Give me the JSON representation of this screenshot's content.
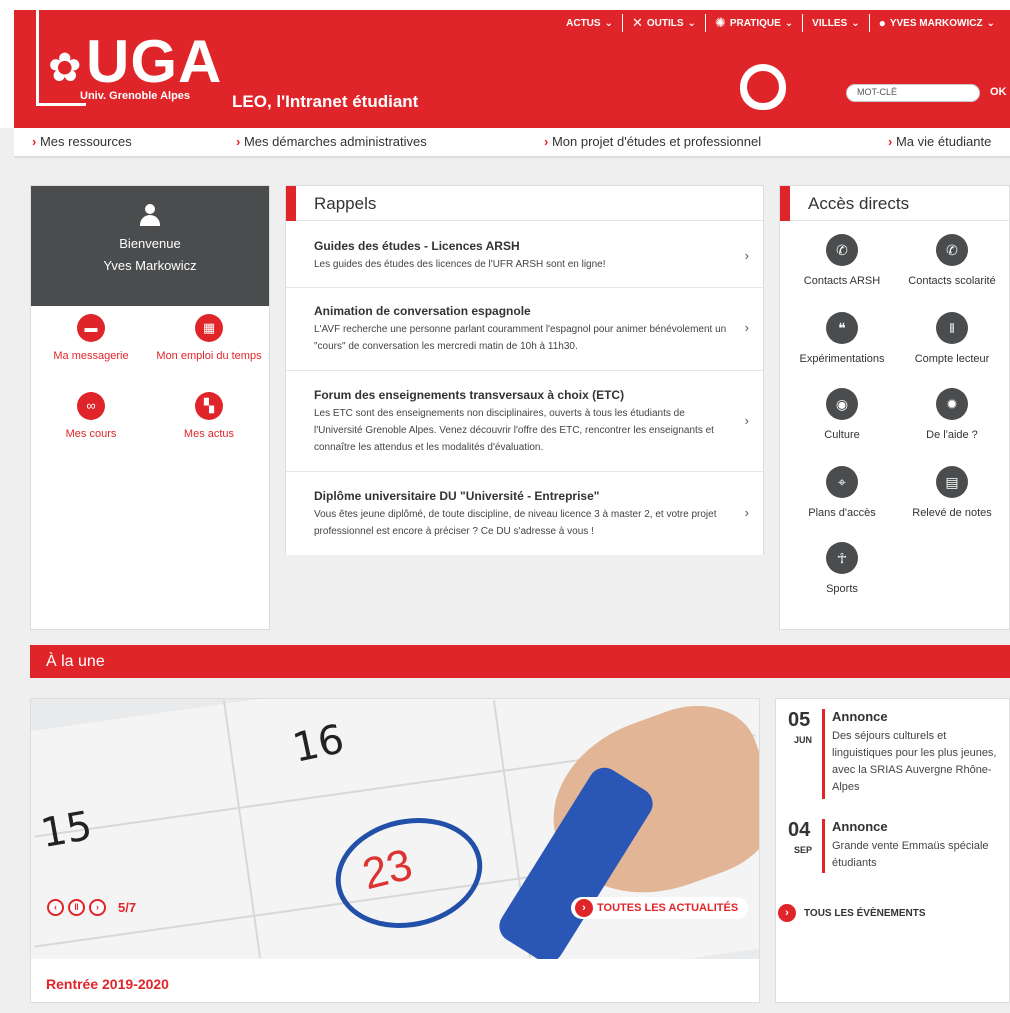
{
  "brand": {
    "logo_text": "UGA",
    "logo_sub": "Univ. Grenoble Alpes",
    "site_title": "LEO, l'Intranet étudiant",
    "color": "#e0252a"
  },
  "topnav": [
    {
      "icon": "",
      "label": "ACTUS"
    },
    {
      "icon": "✕",
      "label": "OUTILS"
    },
    {
      "icon": "✺",
      "label": "PRATIQUE"
    },
    {
      "icon": "",
      "label": "VILLES"
    },
    {
      "icon": "user-icon",
      "label": "YVES MARKOWICZ"
    }
  ],
  "search": {
    "placeholder": "MOT-CLÉ",
    "button": "OK"
  },
  "mainnav": [
    "Mes ressources",
    "Mes démarches administratives",
    "Mon projet d'études et professionnel",
    "Ma vie étudiante"
  ],
  "user": {
    "line1": "Bienvenue",
    "line2": "Yves Markowicz"
  },
  "shortcuts": [
    {
      "label": "Ma messagerie",
      "icon": "message-icon"
    },
    {
      "label": "Mon emploi du temps",
      "icon": "calendar-icon"
    },
    {
      "label": "Mes cours",
      "icon": "link-icon"
    },
    {
      "label": "Mes actus",
      "icon": "grid-icon"
    }
  ],
  "rappels": {
    "title": "Rappels",
    "items": [
      {
        "title": "Guides des études - Licences ARSH",
        "desc": "Les guides des études des licences de l'UFR ARSH sont en ligne!"
      },
      {
        "title": "Animation de conversation espagnole",
        "desc": "L'AVF recherche une personne parlant couramment l'espagnol pour animer bénévolement un \"cours\" de conversation les mercredi matin de 10h à 11h30."
      },
      {
        "title": "Forum des enseignements transversaux à choix (ETC)",
        "desc": "Les ETC sont des enseignements non disciplinaires, ouverts à tous les étudiants de l'Université Grenoble Alpes. Venez découvrir l'offre des ETC, rencontrer les enseignants et connaître les attendus et les modalités d'évaluation."
      },
      {
        "title": "Diplôme universitaire DU \"Université - Entreprise\"",
        "desc": "Vous êtes jeune diplômé, de toute discipline, de niveau licence 3 à master 2, et votre projet professionnel est encore à préciser ? Ce DU s'adresse à vous !"
      }
    ]
  },
  "acces": {
    "title": "Accès directs",
    "items": [
      {
        "label": "Contacts ARSH",
        "icon": "phone-icon"
      },
      {
        "label": "Contacts scolarité",
        "icon": "phone-icon"
      },
      {
        "label": "Expérimentations",
        "icon": "chat-icon"
      },
      {
        "label": "Compte lecteur",
        "icon": "books-icon"
      },
      {
        "label": "Culture",
        "icon": "eye-icon"
      },
      {
        "label": "De l'aide ?",
        "icon": "gear-icon"
      },
      {
        "label": "Plans d'accès",
        "icon": "map-pin-icon"
      },
      {
        "label": "Relevé de notes",
        "icon": "map-icon"
      },
      {
        "label": "Sports",
        "icon": "person-icon"
      }
    ]
  },
  "une": {
    "title": "À la une",
    "counter": "5/7",
    "toutes": "TOUTES LES ACTUALITÉS",
    "feature_title": "Rentrée 2019-2020",
    "photo_numbers": [
      "16",
      "15",
      "23"
    ]
  },
  "events": {
    "items": [
      {
        "day": "05",
        "month": "JUN",
        "title": "Annonce",
        "desc": "Des séjours culturels et linguistiques pour les plus jeunes, avec la SRIAS Auvergne Rhône-Alpes"
      },
      {
        "day": "04",
        "month": "SEP",
        "title": "Annonce",
        "desc": "Grande vente Emmaüs spéciale étudiants"
      }
    ],
    "all": "TOUS LES ÉVÈNEMENTS"
  }
}
